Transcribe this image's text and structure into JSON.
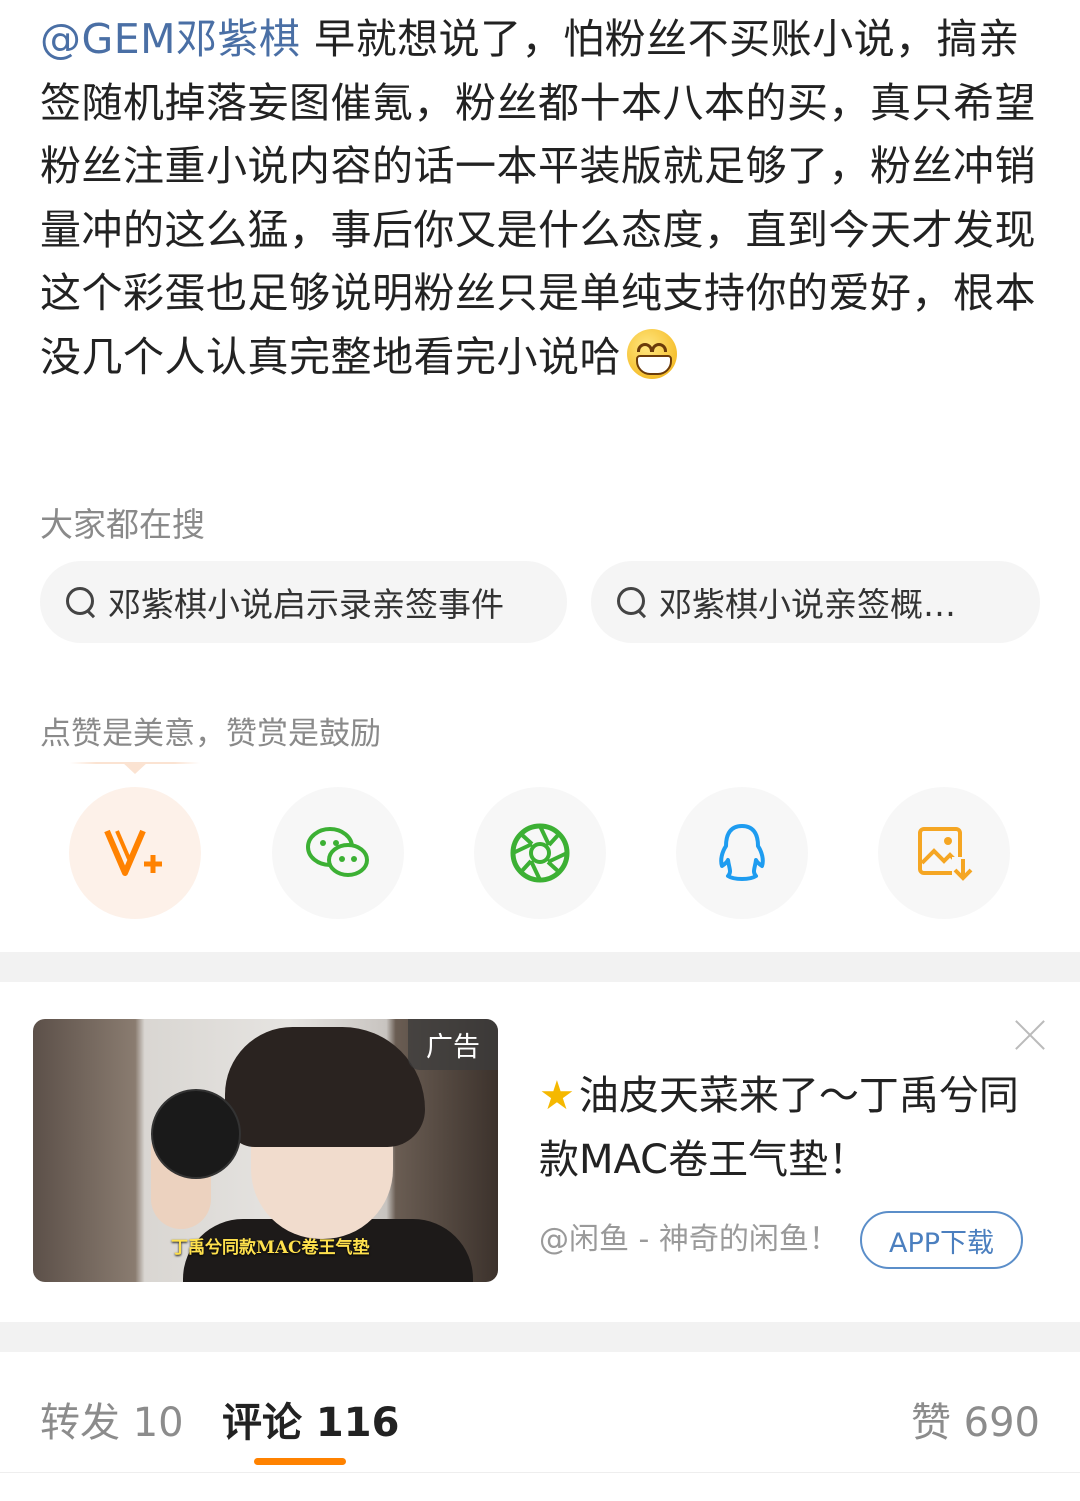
{
  "post": {
    "mention": "@GEM邓紫棋",
    "text": " 早就想说了，怕粉丝不买账小说，搞亲签随机掉落妄图催氪，粉丝都十本八本的买，真只希望粉丝注重小说内容的话一本平装版就足够了，粉丝冲销量冲的这么猛，事后你又是什么态度，直到今天才发现这个彩蛋也足够说明粉丝只是单纯支持你的爱好，根本没几个人认真完整地看完小说哈",
    "emoji": "grin-emoji"
  },
  "search": {
    "title": "大家都在搜",
    "chips": [
      "邓紫棋小说启示录亲签事件",
      "邓紫棋小说亲签概…"
    ]
  },
  "reward": {
    "tip": "点赞是美意，赞赏是鼓励",
    "share_icons": [
      "v-plus-icon",
      "wechat-icon",
      "moments-icon",
      "qq-icon",
      "save-image-icon"
    ],
    "colors": {
      "v": "#ff8200",
      "wechat": "#3cb034",
      "moments": "#3cb034",
      "qq": "#1e9cf0",
      "save": "#f5a623"
    }
  },
  "ad": {
    "badge": "广告",
    "image_caption": "丁禹兮同款MAC卷王气垫",
    "title": "油皮天菜来了～丁禹兮同款MAC卷王气垫！",
    "source": "@闲鱼 - 神奇的闲鱼！",
    "button": "APP下载"
  },
  "tabs": {
    "repost": "转发 10",
    "comments": "评论 116",
    "likes": "赞 690",
    "accent": "#ff8200"
  }
}
